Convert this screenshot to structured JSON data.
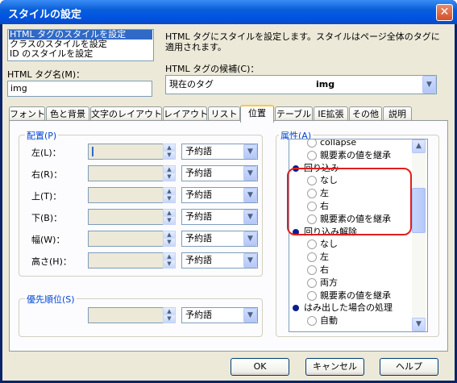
{
  "window": {
    "title": "スタイルの設定",
    "close": "✕"
  },
  "style_type_list": [
    "HTML タグのスタイルを設定",
    "クラスのスタイルを設定",
    "ID のスタイルを設定"
  ],
  "description": "HTML タグにスタイルを設定します。スタイルはページ全体のタグに適用されます。",
  "tag_name": {
    "label": "HTML タグ名(M)：",
    "value": "img"
  },
  "tag_candidate": {
    "label": "HTML タグの候補(C)：",
    "current": "現在のタグ",
    "value": "img"
  },
  "tabs": [
    "フォント",
    "色と背景",
    "文字のレイアウト",
    "レイアウト",
    "リスト",
    "位置",
    "テーブル",
    "IE拡張",
    "その他",
    "説明"
  ],
  "active_tab": "位置",
  "placement": {
    "label": "配置(P)",
    "rows": [
      {
        "label": "左(L)："
      },
      {
        "label": "右(R)："
      },
      {
        "label": "上(T)："
      },
      {
        "label": "下(B)："
      },
      {
        "label": "幅(W)："
      },
      {
        "label": "高さ(H)："
      }
    ],
    "unit": "予約語"
  },
  "priority": {
    "label": "優先順位(S)",
    "unit": "予約語"
  },
  "attributes": {
    "label": "属性(A)",
    "items": [
      {
        "kind": "radio",
        "text": "collapse"
      },
      {
        "kind": "radio",
        "text": "親要素の値を継承"
      },
      {
        "kind": "group",
        "text": "回り込み"
      },
      {
        "kind": "radio",
        "text": "なし"
      },
      {
        "kind": "radio",
        "text": "左"
      },
      {
        "kind": "radio",
        "text": "右"
      },
      {
        "kind": "radio",
        "text": "親要素の値を継承"
      },
      {
        "kind": "group",
        "text": "回り込み解除"
      },
      {
        "kind": "radio",
        "text": "なし"
      },
      {
        "kind": "radio",
        "text": "左"
      },
      {
        "kind": "radio",
        "text": "右"
      },
      {
        "kind": "radio",
        "text": "両方"
      },
      {
        "kind": "radio",
        "text": "親要素の値を継承"
      },
      {
        "kind": "group",
        "text": "はみ出した場合の処理"
      },
      {
        "kind": "radio",
        "text": "自動"
      }
    ]
  },
  "buttons": {
    "ok": "OK",
    "cancel": "キャンセル",
    "help": "ヘルプ"
  },
  "colors": {
    "highlight": "#e01e1e",
    "accent": "#316ac5"
  }
}
